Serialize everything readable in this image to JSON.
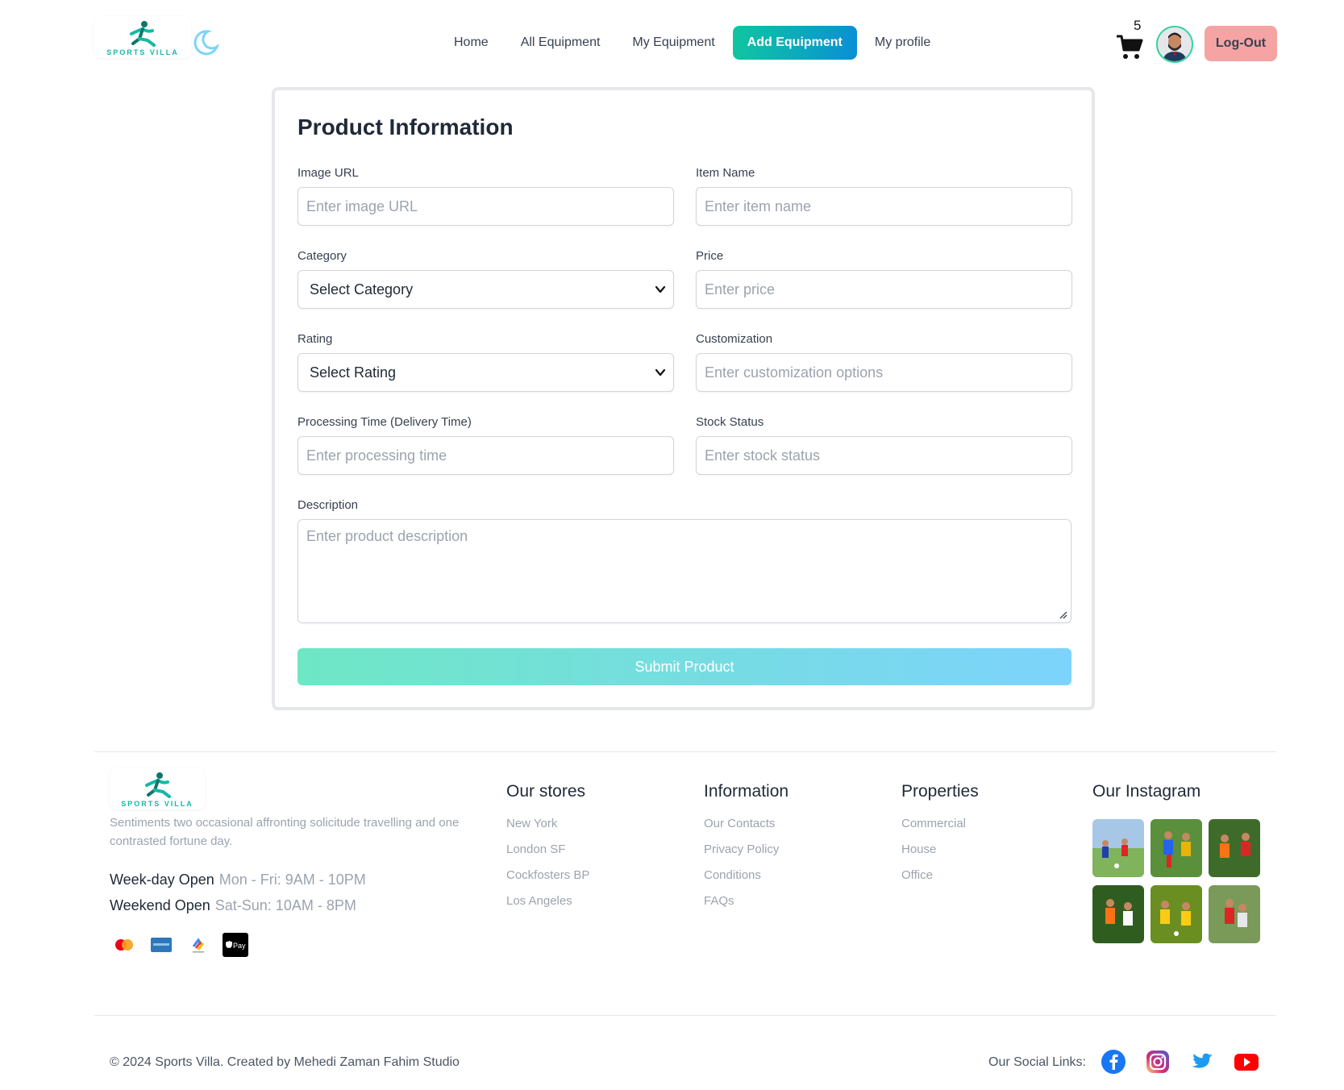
{
  "nav": {
    "brand_text": "SPORTS VILLA",
    "links": [
      {
        "label": "Home",
        "active": false
      },
      {
        "label": "All Equipment",
        "active": false
      },
      {
        "label": "My Equipment",
        "active": false
      },
      {
        "label": "Add Equipment",
        "active": true
      },
      {
        "label": "My profile",
        "active": false
      }
    ],
    "cart_count": "5",
    "logout_label": "Log-Out",
    "theme_icon": "moon-icon",
    "cart_icon": "cart-icon"
  },
  "form": {
    "title": "Product Information",
    "fields": {
      "image_url": {
        "label": "Image URL",
        "placeholder": "Enter image URL"
      },
      "item_name": {
        "label": "Item Name",
        "placeholder": "Enter item name"
      },
      "category": {
        "label": "Category",
        "value": "Select Category"
      },
      "price": {
        "label": "Price",
        "placeholder": "Enter price"
      },
      "rating": {
        "label": "Rating",
        "value": "Select Rating"
      },
      "customization": {
        "label": "Customization",
        "placeholder": "Enter customization options"
      },
      "processing_time": {
        "label": "Processing Time (Delivery Time)",
        "placeholder": "Enter processing time"
      },
      "stock_status": {
        "label": "Stock Status",
        "placeholder": "Enter stock status"
      },
      "description": {
        "label": "Description",
        "placeholder": "Enter product description"
      }
    },
    "submit_label": "Submit Product"
  },
  "footer": {
    "brand_text": "SPORTS VILLA",
    "description": "Sentiments two occasional affronting solicitude travelling and one contrasted fortune day.",
    "weekday_label": "Week-day Open",
    "weekday_value": "Mon - Fri: 9AM - 10PM",
    "weekend_label": "Weekend Open",
    "weekend_value": "Sat-Sun: 10AM - 8PM",
    "payment_icons": [
      "mastercard-icon",
      "amex-icon",
      "google-pay-icon",
      "apple-pay-icon"
    ],
    "apple_pay_text": "Pay",
    "columns": [
      {
        "title": "Our stores",
        "items": [
          "New York",
          "London SF",
          "Cockfosters BP",
          "Los Angeles"
        ]
      },
      {
        "title": "Information",
        "items": [
          "Our Contacts",
          "Privacy Policy",
          "Conditions",
          "FAQs"
        ]
      },
      {
        "title": "Properties",
        "items": [
          "Commercial",
          "House",
          "Office"
        ]
      }
    ],
    "instagram_title": "Our Instagram",
    "copyright": "© 2024 Sports Villa. Created by Mehedi Zaman Fahim Studio",
    "social_label": "Our Social Links:",
    "social_icons": [
      "facebook-icon",
      "instagram-icon",
      "twitter-icon",
      "youtube-icon"
    ]
  },
  "colors": {
    "accent_gradient_start": "#10c6a0",
    "accent_gradient_end": "#0a8fd6",
    "logout_bg": "#f5a3a3",
    "brand_teal": "#14b8a6"
  }
}
